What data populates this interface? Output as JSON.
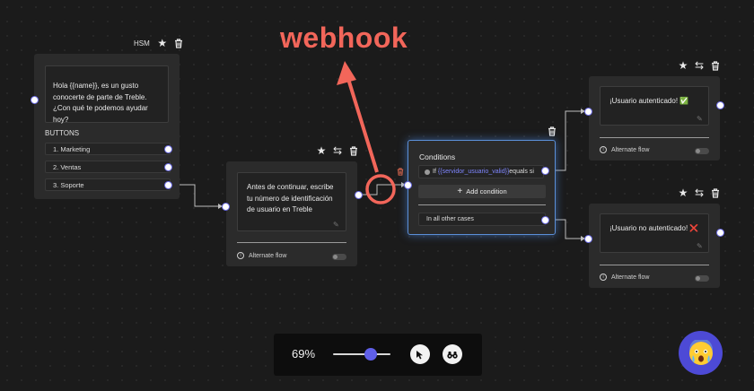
{
  "annotation": {
    "label": "webhook",
    "color": "#f2665a"
  },
  "hsm_node": {
    "badge": "HSM",
    "message": "Hola {{name}}, es un gusto conocerte de parte de Treble. ¿Con qué te podemos ayudar hoy?",
    "buttons_title": "BUTTONS",
    "buttons": [
      "1.  Marketing",
      "2.  Ventas",
      "3.  Soporte"
    ]
  },
  "question_node": {
    "message": "Antes de continuar, escribe tu número de identificación de usuario en Treble",
    "alt_flow": "Alternate flow"
  },
  "conditions_node": {
    "title": "Conditions",
    "cond_if": "If",
    "cond_var": "{{servidor_usuario_valid}}",
    "cond_op": "equals si",
    "add_condition": "Add condition",
    "else": "In all other cases"
  },
  "auth_node": {
    "message": "¡Usuario autenticado! ✅",
    "alt_flow": "Alternate flow"
  },
  "noauth_node": {
    "message": "¡Usuario no autenticado! ❌",
    "alt_flow": "Alternate flow"
  },
  "zoom": {
    "level": "69%",
    "value": 0.69
  },
  "colors": {
    "accent": "#6c6cf0",
    "canvas": "#1b1b1b",
    "node": "#2b2b2b"
  }
}
